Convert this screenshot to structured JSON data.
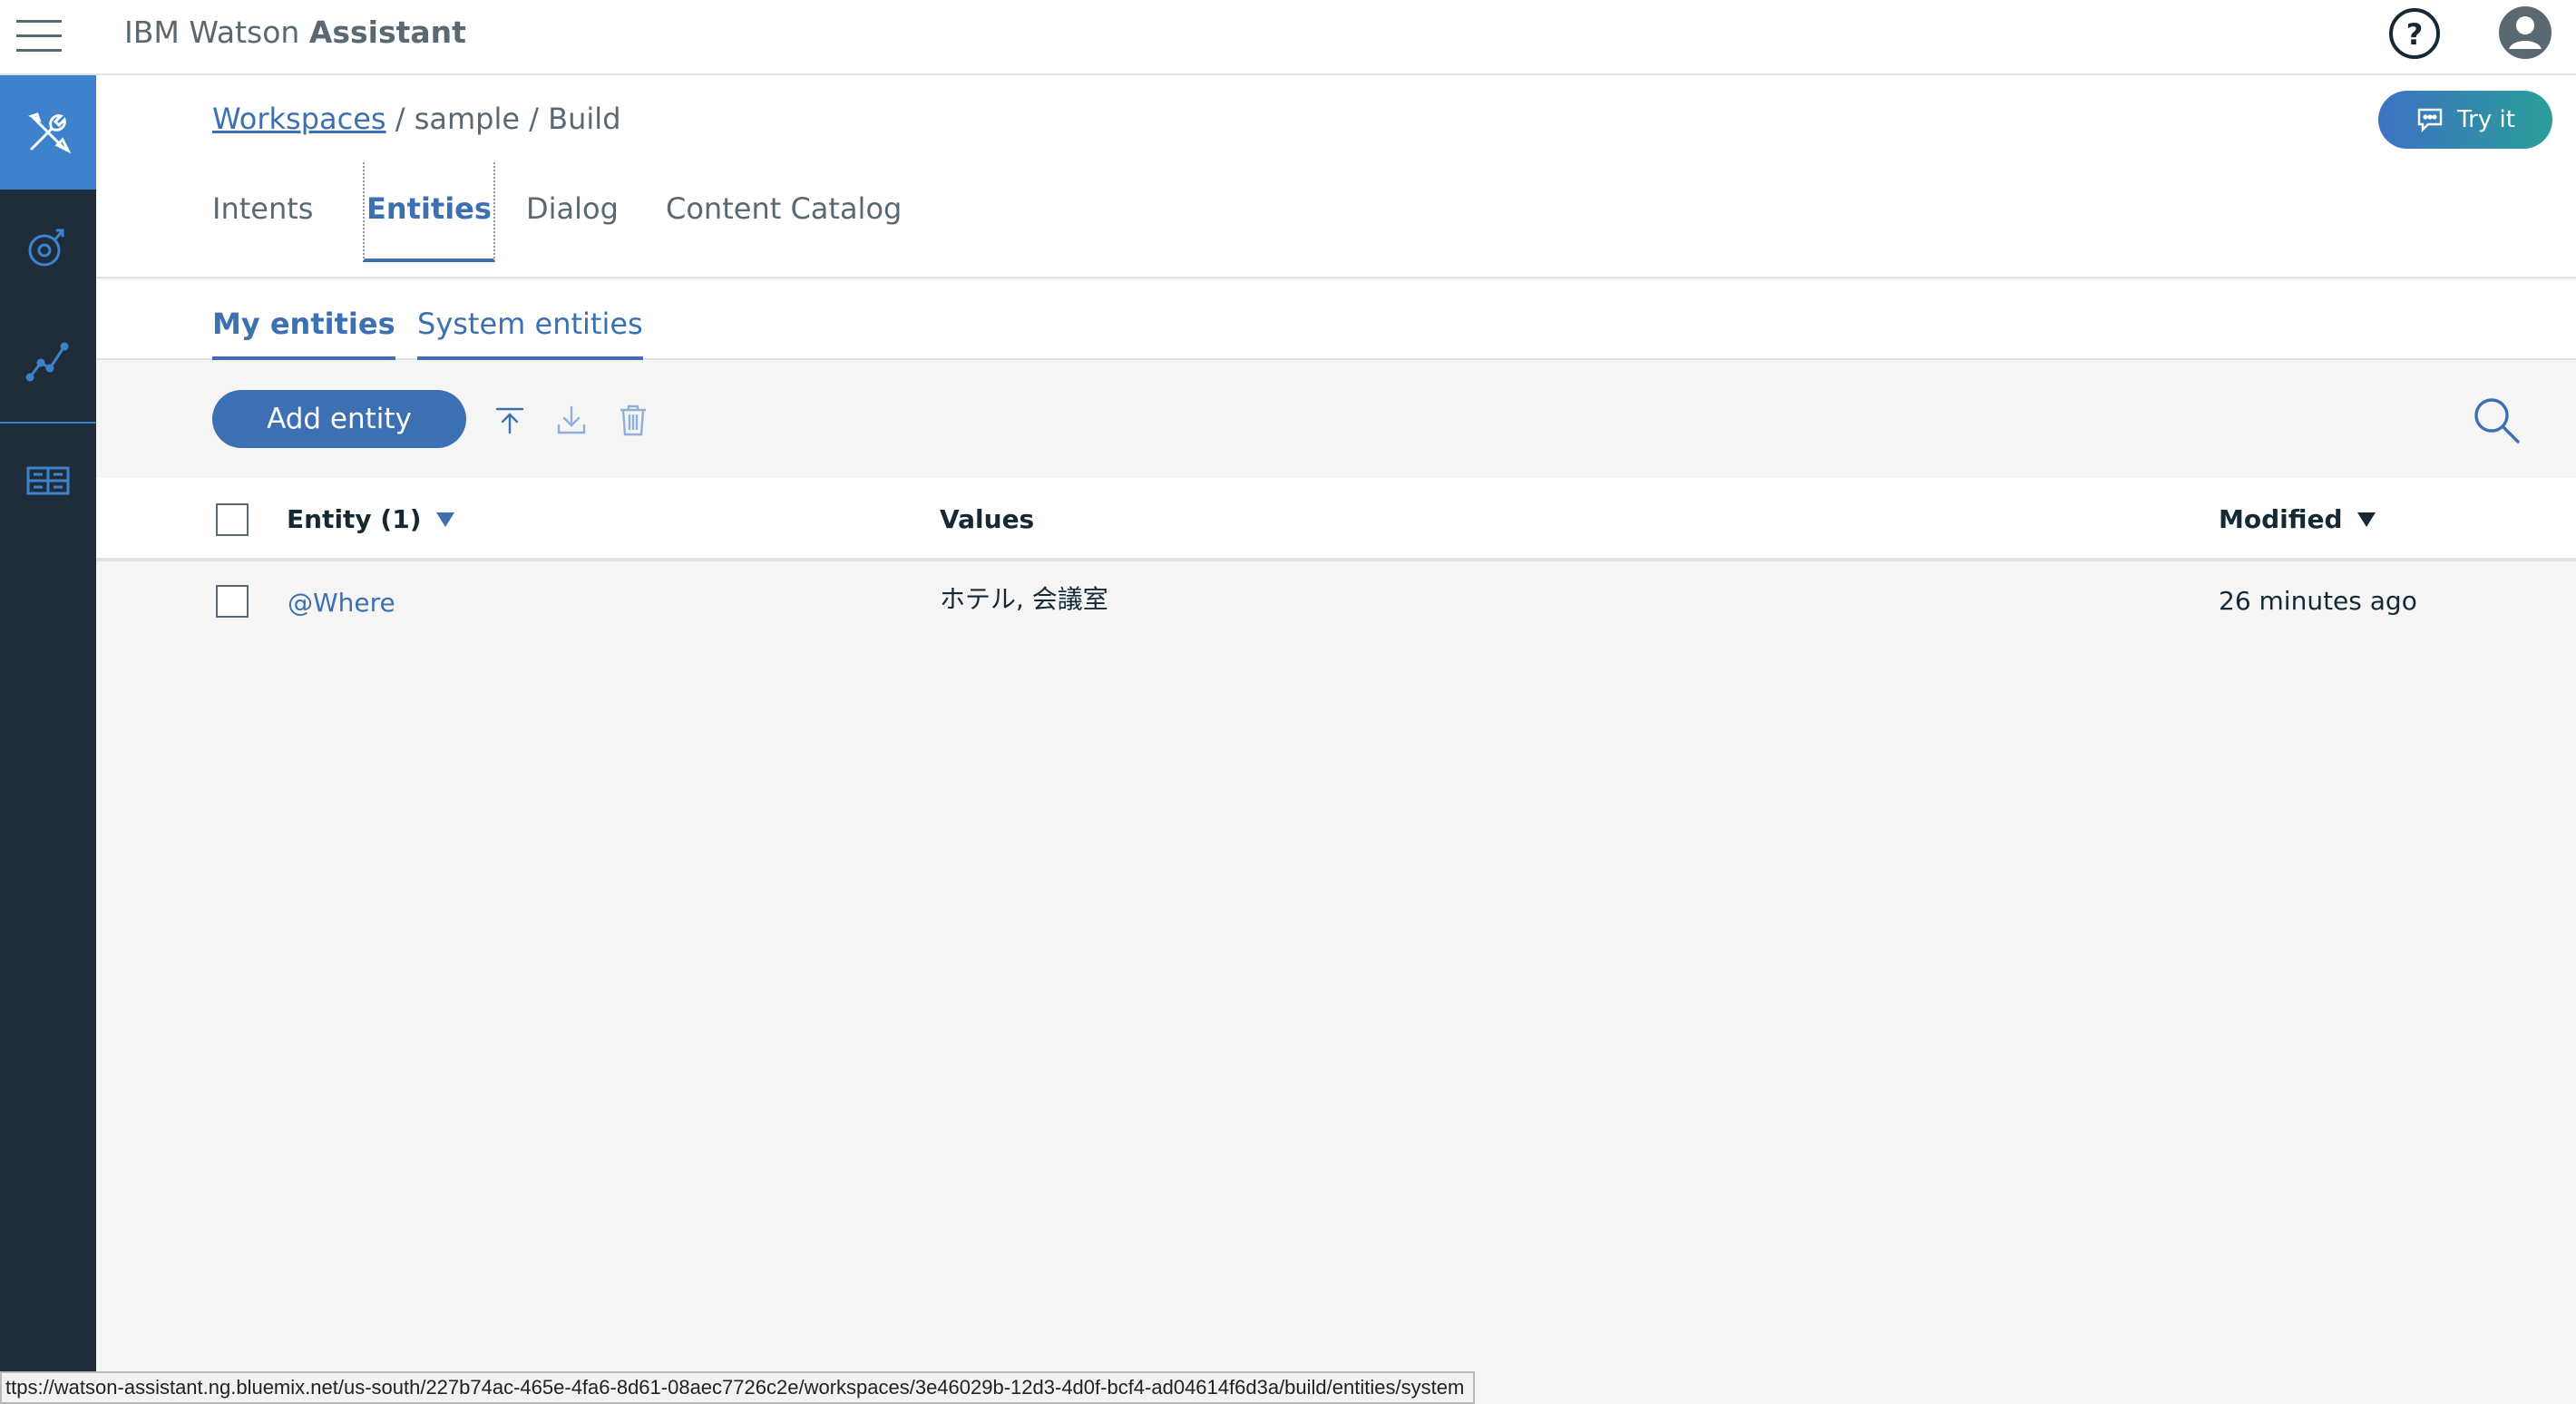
{
  "topbar": {
    "brand_regular": "IBM Watson ",
    "brand_bold": "Assistant",
    "menu_icon": "hamburger-menu-icon",
    "help_icon": "help-icon",
    "user_icon": "user-avatar-icon"
  },
  "sidebar": {
    "items": [
      {
        "icon": "build-tools-icon",
        "active": true
      },
      {
        "icon": "improve-icon",
        "active": false
      },
      {
        "icon": "analytics-icon",
        "active": false
      },
      {
        "icon": "workspaces-grid-icon",
        "active": false
      }
    ]
  },
  "breadcrumb": {
    "link": "Workspaces",
    "rest": " / sample / Build"
  },
  "try_button": {
    "label": "Try it",
    "icon": "chat-bubble-icon"
  },
  "main_tabs": [
    "Intents",
    "Entities",
    "Dialog",
    "Content Catalog"
  ],
  "active_main_tab": "Entities",
  "sub_tabs": [
    "My entities",
    "System entities"
  ],
  "toolbar": {
    "add_label": "Add entity",
    "icons": [
      "upload-icon",
      "download-icon",
      "trash-icon",
      "search-icon"
    ]
  },
  "table": {
    "columns": {
      "entity": "Entity (1)",
      "values": "Values",
      "modified": "Modified"
    },
    "rows": [
      {
        "entity": "@Where",
        "values": "ホテル, 会議室",
        "modified": "26 minutes ago"
      }
    ]
  },
  "status_url": "ttps://watson-assistant.ng.bluemix.net/us-south/227b74ac-465e-4fa6-8d61-08aec7726c2e/workspaces/3e46029b-12d3-4d0f-bcf4-ad04614f6d3a/build/entities/system",
  "colors": {
    "accent": "#3d70b2",
    "sidebar_bg": "#1f2d3a",
    "sidebar_active": "#3d82cc"
  }
}
